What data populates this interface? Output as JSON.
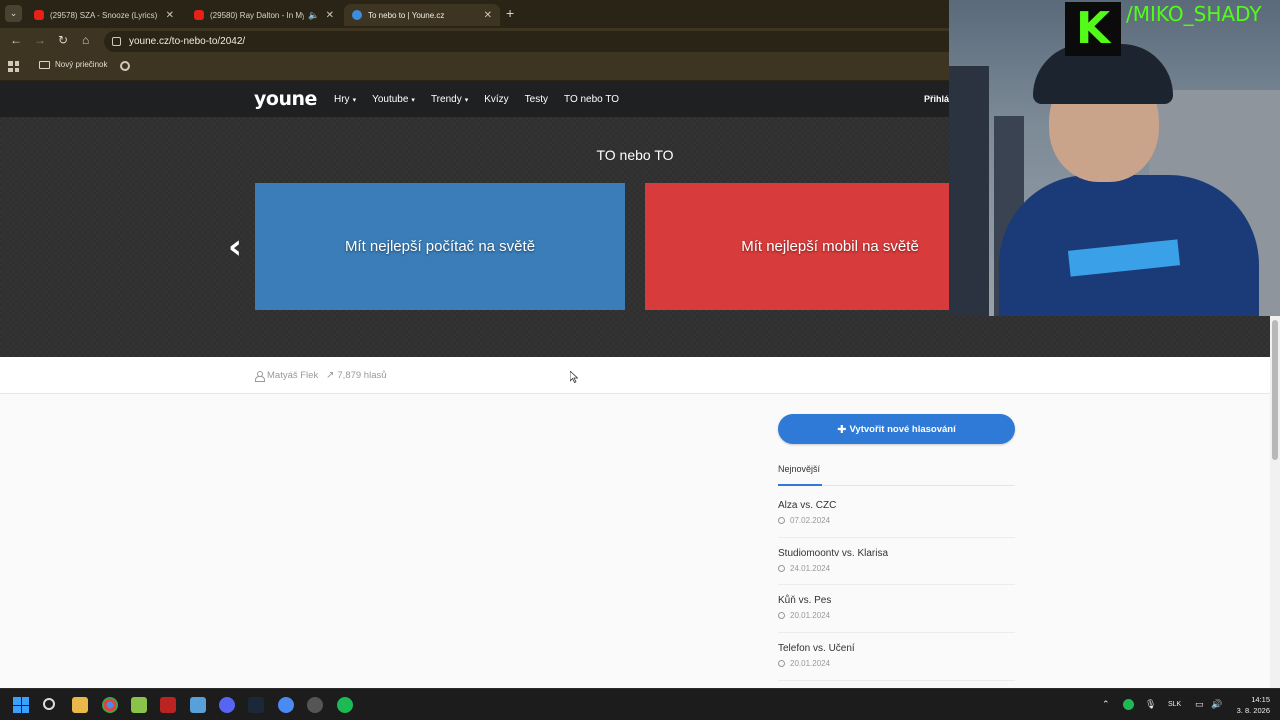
{
  "browser": {
    "tabs": [
      {
        "title": "(29578) SZA - Snooze (Lyrics) -",
        "favicon": "youtube-icon",
        "active": false
      },
      {
        "title": "(29580) Ray Dalton - In My",
        "favicon": "youtube-icon",
        "active": false,
        "audio": "speaker-icon"
      },
      {
        "title": "To nebo to | Youne.cz",
        "favicon": "youne-icon",
        "active": true
      }
    ],
    "url": "youne.cz/to-nebo-to/2042/",
    "bookmark_folder": "Nový priečinok"
  },
  "site": {
    "logo": "youne",
    "nav": [
      {
        "label": "Hry",
        "has_caret": true
      },
      {
        "label": "Youtube",
        "has_caret": true
      },
      {
        "label": "Trendy",
        "has_caret": true
      },
      {
        "label": "Kvízy",
        "has_caret": false
      },
      {
        "label": "Testy",
        "has_caret": false
      },
      {
        "label": "TO nebo TO",
        "has_caret": false
      }
    ],
    "login_label": "Přihlá"
  },
  "hero": {
    "title": "TO nebo TO",
    "option_a": "Mít nejlepší počítač na světě",
    "option_b": "Mít nejlepší mobil na světě",
    "colors": {
      "option_a": "#3a7db8",
      "option_b": "#d83b3b"
    }
  },
  "meta": {
    "author": "Matyáš Flek",
    "votes": "7,879 hlasů"
  },
  "sidebar": {
    "create_button": "Vytvořit nové hlasování",
    "tab_label": "Nejnovější",
    "latest": [
      {
        "title": "Alza vs. CZC",
        "date": "07.02.2024"
      },
      {
        "title": "Studiomoontv vs. Klarisa",
        "date": "24.01.2024"
      },
      {
        "title": "Kůň vs. Pes",
        "date": "20.01.2024"
      },
      {
        "title": "Telefon vs. Učení",
        "date": "20.01.2024"
      }
    ]
  },
  "overlay": {
    "handle": "/MIKO_SHADY",
    "logo_letter": "K"
  },
  "taskbar": {
    "language": "SLK",
    "time": "14:15",
    "date": "3. 8. 2026"
  }
}
